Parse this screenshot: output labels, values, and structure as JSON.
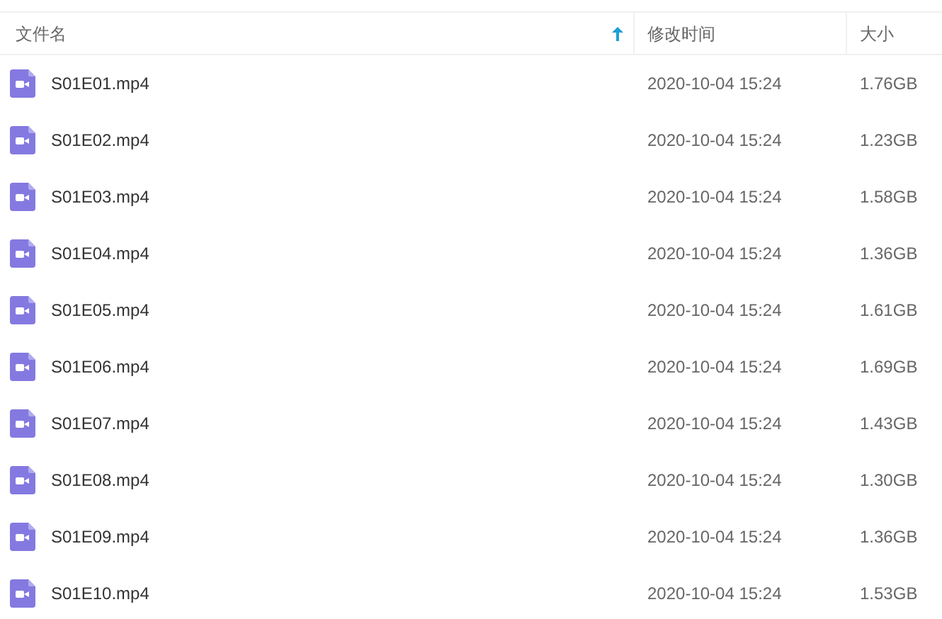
{
  "table": {
    "columns": [
      {
        "label": "文件名",
        "sorted": true
      },
      {
        "label": "修改时间",
        "sorted": false
      },
      {
        "label": "大小",
        "sorted": false
      }
    ],
    "rows": [
      {
        "name": "S01E01.mp4",
        "modified": "2020-10-04 15:24",
        "size": "1.76GB"
      },
      {
        "name": "S01E02.mp4",
        "modified": "2020-10-04 15:24",
        "size": "1.23GB"
      },
      {
        "name": "S01E03.mp4",
        "modified": "2020-10-04 15:24",
        "size": "1.58GB"
      },
      {
        "name": "S01E04.mp4",
        "modified": "2020-10-04 15:24",
        "size": "1.36GB"
      },
      {
        "name": "S01E05.mp4",
        "modified": "2020-10-04 15:24",
        "size": "1.61GB"
      },
      {
        "name": "S01E06.mp4",
        "modified": "2020-10-04 15:24",
        "size": "1.69GB"
      },
      {
        "name": "S01E07.mp4",
        "modified": "2020-10-04 15:24",
        "size": "1.43GB"
      },
      {
        "name": "S01E08.mp4",
        "modified": "2020-10-04 15:24",
        "size": "1.30GB"
      },
      {
        "name": "S01E09.mp4",
        "modified": "2020-10-04 15:24",
        "size": "1.36GB"
      },
      {
        "name": "S01E10.mp4",
        "modified": "2020-10-04 15:24",
        "size": "1.53GB"
      }
    ]
  }
}
